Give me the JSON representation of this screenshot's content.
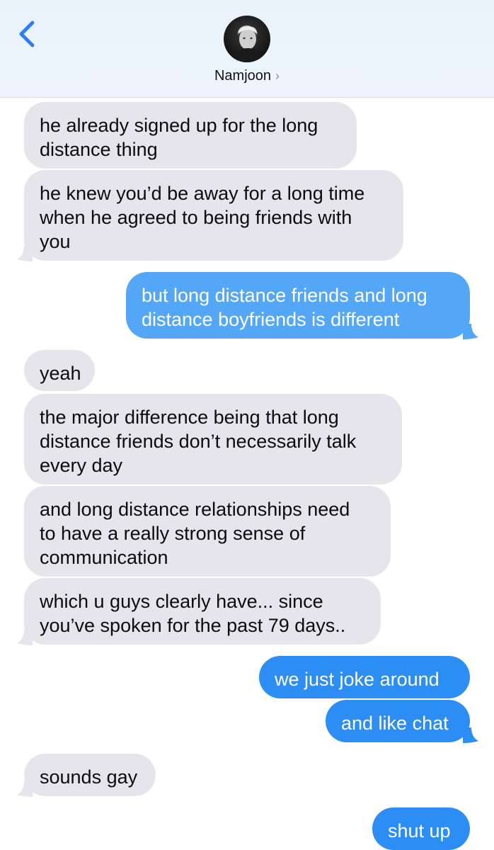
{
  "header": {
    "contact_name": "Namjoon",
    "chevron": "›",
    "back_icon": "chevron-left-icon",
    "accent": "#2c8df5"
  },
  "messages": [
    {
      "side": "received",
      "text": "he already signed up for the long\ndistance thing"
    },
    {
      "side": "received",
      "text": "he knew you’d be away for a long time\nwhen he agreed to being friends with\nyou"
    },
    {
      "side": "sent",
      "text": "but long distance friends and long\ndistance boyfriends is different"
    },
    {
      "side": "received",
      "text": "yeah"
    },
    {
      "side": "received",
      "text": "the major difference being that long\ndistance friends don’t necessarily talk\nevery day"
    },
    {
      "side": "received",
      "text": "and long distance relationships need\nto have a really strong sense of\ncommunication"
    },
    {
      "side": "received",
      "text": "which u guys clearly have... since\nyou’ve spoken for the past 79 days.."
    },
    {
      "side": "sent",
      "text": "we just joke around"
    },
    {
      "side": "sent",
      "text": "and like chat"
    },
    {
      "side": "received",
      "text": "sounds gay"
    },
    {
      "side": "sent",
      "text": "shut up"
    }
  ],
  "colors": {
    "received_bubble": "#e6e5eb",
    "sent_bubble": "#2c8df5"
  }
}
